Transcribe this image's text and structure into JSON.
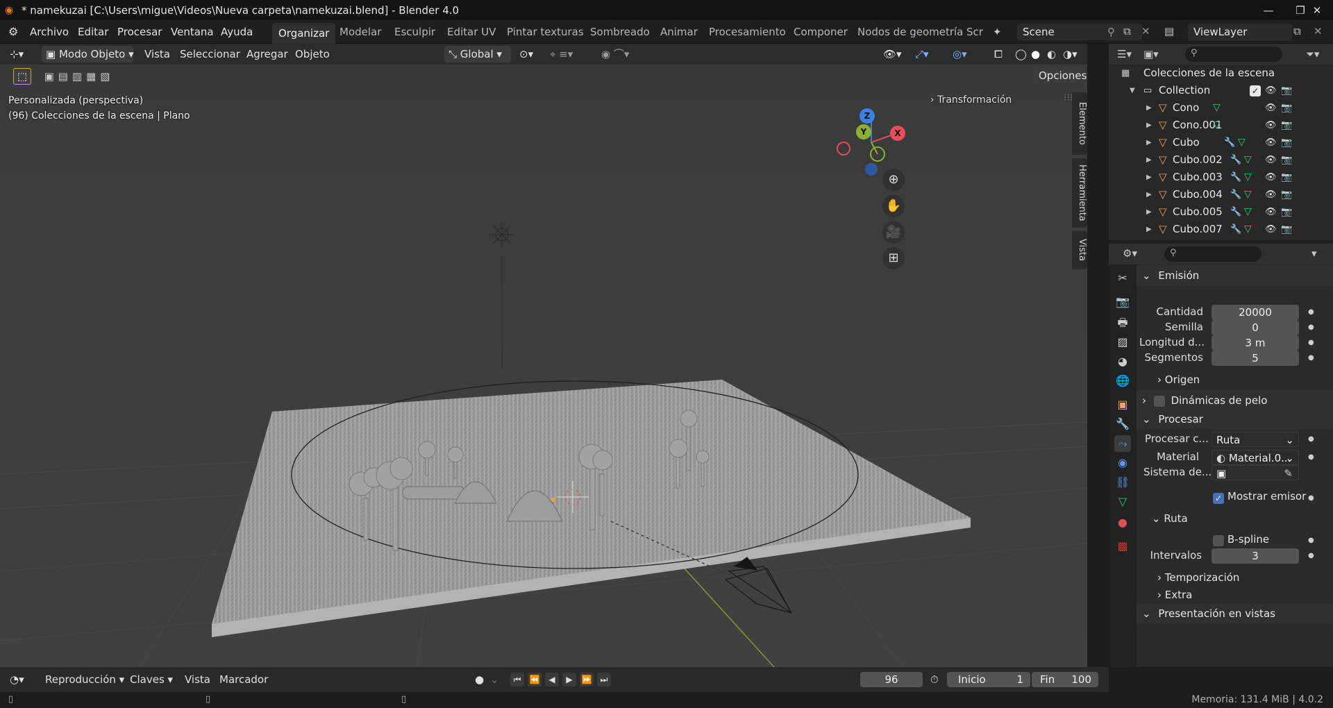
{
  "window": {
    "title": "* namekuzai [C:\\Users\\migue\\Videos\\Nueva carpeta\\namekuzai.blend] - Blender 4.0"
  },
  "menu": {
    "items": [
      "Archivo",
      "Editar",
      "Procesar",
      "Ventana",
      "Ayuda"
    ],
    "workspaces": [
      "Organizar",
      "Modelar",
      "Esculpir",
      "Editar UV",
      "Pintar texturas",
      "Sombreado",
      "Animar",
      "Procesamiento",
      "Componer",
      "Nodos de geometría",
      "Scr"
    ],
    "active_workspace": "Organizar",
    "scene": "Scene",
    "view_layer": "ViewLayer"
  },
  "viewport_header": {
    "mode": "Modo Objeto",
    "menus": [
      "Vista",
      "Seleccionar",
      "Agregar",
      "Objeto"
    ],
    "transform_orientation": "Global",
    "options_label": "Opciones"
  },
  "viewport": {
    "view_name": "Personalizada (perspectiva)",
    "context_line": "(96) Colecciones de la escena | Plano",
    "sidebar_panel": "Transformación",
    "side_tabs": [
      "Elemento",
      "Herramienta",
      "Vista"
    ],
    "gizmo_axes": {
      "z": "Z",
      "y": "Y",
      "x": "X"
    }
  },
  "outliner": {
    "root": "Colecciones de la escena",
    "collection": "Collection",
    "objects": [
      "Cono",
      "Cono.001",
      "Cubo",
      "Cubo.002",
      "Cubo.003",
      "Cubo.004",
      "Cubo.005",
      "Cubo.007"
    ]
  },
  "properties": {
    "emission": {
      "title": "Emisión",
      "fields": [
        {
          "label": "Cantidad",
          "value": "20000"
        },
        {
          "label": "Semilla",
          "value": "0"
        },
        {
          "label": "Longitud d...",
          "value": "3 m"
        },
        {
          "label": "Segmentos",
          "value": "5"
        }
      ],
      "origin": "Origen"
    },
    "hair_dynamics": "Dinámicas de pelo",
    "render": {
      "title": "Procesar",
      "render_as_label": "Procesar c...",
      "render_as_value": "Ruta",
      "material_label": "Material",
      "material_value": "Material.0...",
      "coord_label": "Sistema de...",
      "show_emitter": "Mostrar emisor",
      "path_title": "Ruta",
      "bspline": "B-spline",
      "steps_label": "Intervalos",
      "steps_value": "3",
      "timing": "Temporización",
      "extra": "Extra"
    },
    "viewport_display": "Presentación en vistas"
  },
  "timeline": {
    "playback": "Reproducción",
    "keying": "Claves",
    "view": "Vista",
    "marker": "Marcador",
    "current_frame": "96",
    "start_label": "Inicio",
    "start_value": "1",
    "end_label": "Fin",
    "end_value": "100"
  },
  "status": {
    "text": "Memoria: 131.4 MiB | 4.0.2"
  },
  "colors": {
    "accent": "#4772b3",
    "orange": "#f0a552",
    "axis_x": "#e74b5c",
    "axis_y": "#8ab130",
    "axis_z": "#3b82e0"
  }
}
